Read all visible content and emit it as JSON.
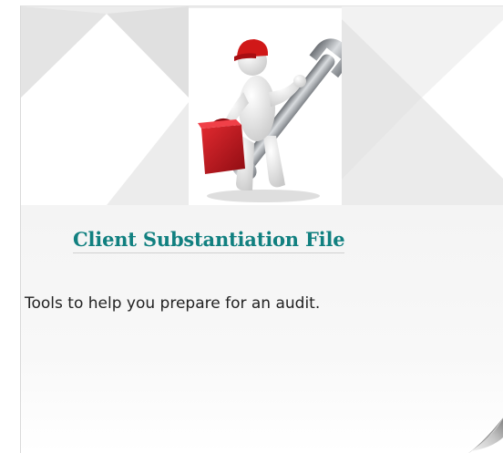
{
  "tile": {
    "title": "Client Substantiation File",
    "description": "Tools to help you prepare for an audit.",
    "illustration_icon": "figure-with-wrench-and-toolbox-icon",
    "corner_icon": "page-curl-icon",
    "colors": {
      "title": "#118080",
      "text": "#222222",
      "toolbox": "#c8141e",
      "cap": "#d01818",
      "wrench": "#9ea3a8"
    }
  }
}
